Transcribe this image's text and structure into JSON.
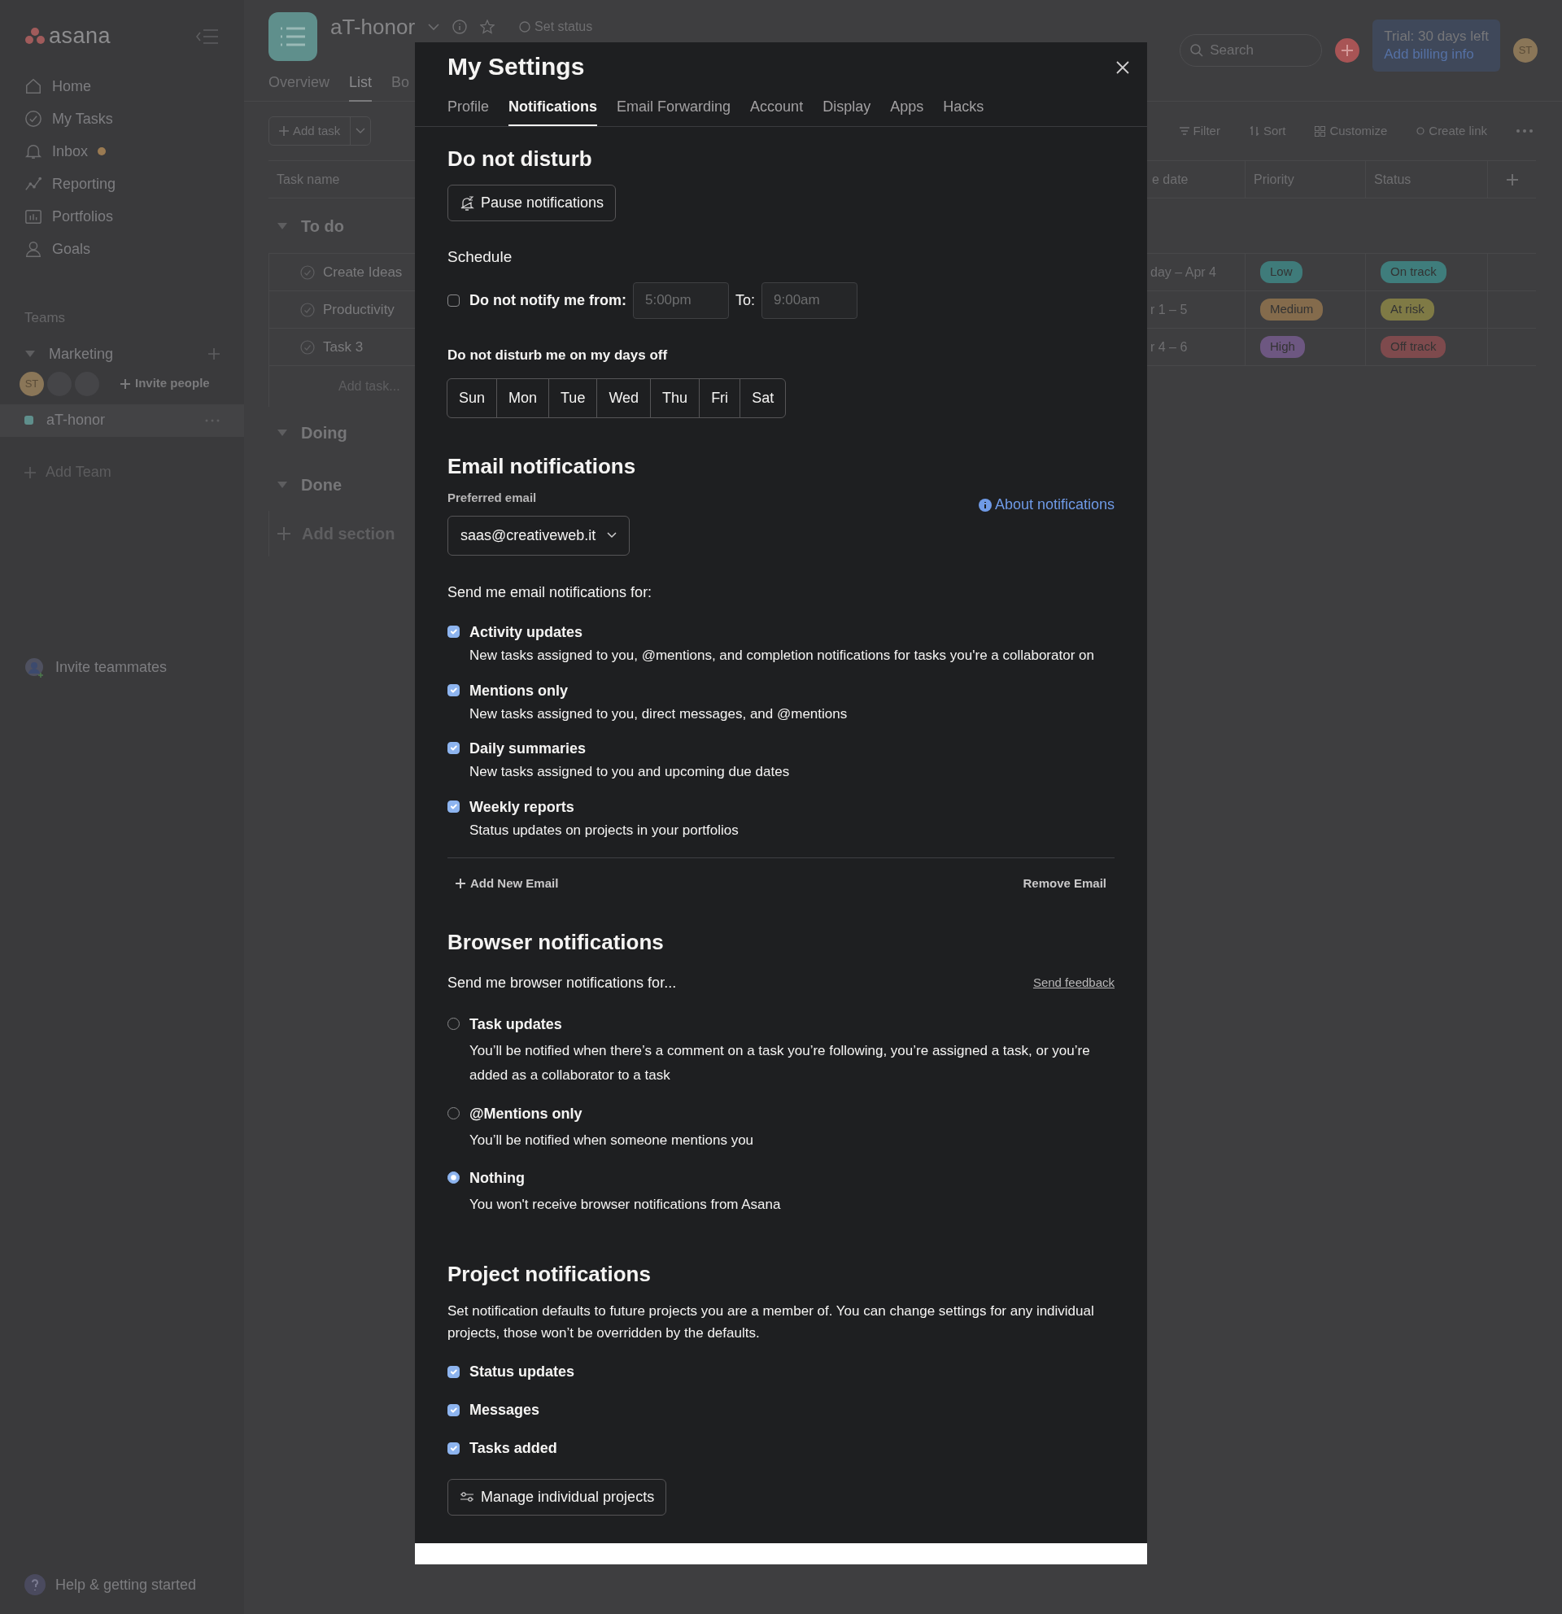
{
  "sidebar": {
    "logo": "asana",
    "nav": [
      {
        "label": "Home"
      },
      {
        "label": "My Tasks"
      },
      {
        "label": "Inbox",
        "unread": true
      },
      {
        "label": "Reporting"
      },
      {
        "label": "Portfolios"
      },
      {
        "label": "Goals"
      }
    ],
    "teams_heading": "Teams",
    "team": {
      "name": "Marketing",
      "expanded": true,
      "avatar": "ST",
      "invite": "Invite people"
    },
    "projects": [
      {
        "name": "aT-honor",
        "selected": true,
        "color": "#5f8f8c"
      }
    ],
    "add_team": "Add Team",
    "invite_teammates": "Invite teammates",
    "help": "Help & getting started"
  },
  "topbar": {
    "search_placeholder": "Search",
    "trial": "Trial: 30 days left",
    "billing": "Add billing info",
    "avatar": "ST"
  },
  "project": {
    "title": "aT-honor",
    "set_status": "Set status",
    "tabs": [
      {
        "label": "Overview",
        "selected": false
      },
      {
        "label": "List",
        "selected": true
      },
      {
        "label": "Bo",
        "selected": false
      }
    ],
    "add_task": "Add task",
    "tools": [
      "Filter",
      "Sort",
      "Customize",
      "Create link"
    ]
  },
  "table": {
    "columns": [
      "Task name",
      "e date",
      "Priority",
      "Status"
    ],
    "sections": [
      {
        "name": "To do",
        "expanded": true,
        "tasks": [
          {
            "name": "Create Ideas",
            "due": "day – Apr 4",
            "priority": {
              "label": "Low",
              "color": "#3f7b7a"
            },
            "status": {
              "label": "On track",
              "color": "#3f7d7c"
            }
          },
          {
            "name": "Productivity",
            "due": "r 1 – 5",
            "priority": {
              "label": "Medium",
              "color": "#846b4c"
            },
            "status": {
              "label": "At risk",
              "color": "#7f7a45"
            }
          },
          {
            "name": "Task 3",
            "due": "r 4 – 6",
            "priority": {
              "label": "High",
              "color": "#6d5781"
            },
            "status": {
              "label": "Off track",
              "color": "#7e4a4d"
            }
          }
        ],
        "add_task": "Add task..."
      },
      {
        "name": "Doing",
        "expanded": true
      },
      {
        "name": "Done",
        "expanded": true
      }
    ],
    "add_section": "Add section"
  },
  "modal": {
    "title": "My Settings",
    "tabs": [
      {
        "label": "Profile",
        "selected": false
      },
      {
        "label": "Notifications",
        "selected": true
      },
      {
        "label": "Email Forwarding",
        "selected": false
      },
      {
        "label": "Account",
        "selected": false
      },
      {
        "label": "Display",
        "selected": false
      },
      {
        "label": "Apps",
        "selected": false
      },
      {
        "label": "Hacks",
        "selected": false
      }
    ],
    "dnd": {
      "heading": "Do not disturb",
      "pause_button": "Pause notifications",
      "schedule_heading": "Schedule",
      "schedule": {
        "label": "Do not notify me from:",
        "checked": false,
        "from": "5:00pm",
        "to_label": "To:",
        "to": "9:00am",
        "disabled": true
      },
      "days_heading": "Do not disturb me on my days off",
      "days": [
        {
          "label": "Sun",
          "selected": false
        },
        {
          "label": "Mon",
          "selected": false
        },
        {
          "label": "Tue",
          "selected": false
        },
        {
          "label": "Wed",
          "selected": false
        },
        {
          "label": "Thu",
          "selected": false
        },
        {
          "label": "Fri",
          "selected": false
        },
        {
          "label": "Sat",
          "selected": false
        }
      ]
    },
    "email": {
      "heading": "Email notifications",
      "preferred_label": "Preferred email",
      "email": "saas@creativeweb.it",
      "about_link": "About notifications",
      "intro": "Send me email notifications for:",
      "options": [
        {
          "title": "Activity updates",
          "desc": "New tasks assigned to you, @mentions, and completion notifications for tasks you're a collaborator on",
          "checked": true
        },
        {
          "title": "Mentions only",
          "desc": "New tasks assigned to you, direct messages, and @mentions",
          "checked": true
        },
        {
          "title": "Daily summaries",
          "desc": "New tasks assigned to you and upcoming due dates",
          "checked": true
        },
        {
          "title": "Weekly reports",
          "desc": "Status updates on projects in your portfolios",
          "checked": true
        }
      ],
      "add_email": "Add New Email",
      "remove_email": "Remove Email"
    },
    "browser": {
      "heading": "Browser notifications",
      "intro": "Send me browser notifications for...",
      "feedback_link": "Send feedback",
      "options": [
        {
          "title": "Task updates",
          "desc": "You’ll be notified when there’s a comment on a task you’re following, you’re assigned a task, or you’re added as a collaborator to a task",
          "selected": false
        },
        {
          "title": "@Mentions only",
          "desc": "You’ll be notified when someone mentions you",
          "selected": false
        },
        {
          "title": "Nothing",
          "desc": "You won't receive browser notifications from Asana",
          "selected": true
        }
      ]
    },
    "project": {
      "heading": "Project notifications",
      "desc": "Set notification defaults to future projects you are a member of. You can change settings for any individual projects, those won’t be overridden by the defaults.",
      "options": [
        {
          "label": "Status updates",
          "checked": true
        },
        {
          "label": "Messages",
          "checked": true
        },
        {
          "label": "Tasks added",
          "checked": true
        }
      ],
      "manage_button": "Manage individual projects"
    }
  }
}
